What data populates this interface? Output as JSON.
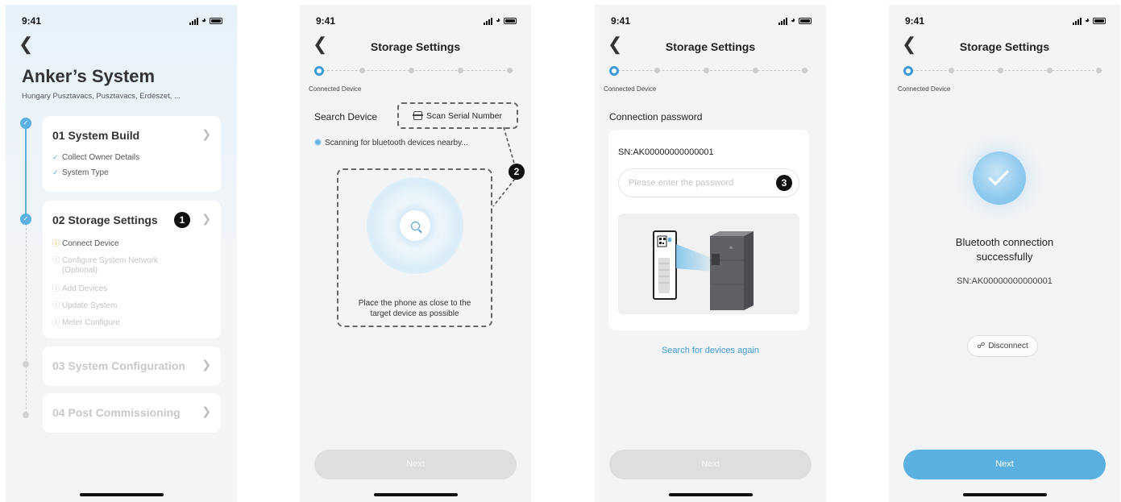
{
  "status_time": "9:41",
  "screen1": {
    "title": "Anker’s System",
    "address": "Hungary Pusztavacs, Pusztavacs, Erdészet, ...",
    "steps": [
      {
        "label": "01 System Build",
        "items": [
          "Collect Owner Details",
          "System Type"
        ]
      },
      {
        "label": "02 Storage Settings",
        "items": [
          "Connect Device",
          "Configure System Network",
          "(Optional)",
          "Add Devices",
          "Update System",
          "Meter Configure"
        ]
      },
      {
        "label": "03 System Configuration"
      },
      {
        "label": "04 Post Commissioning"
      }
    ],
    "badge": "1"
  },
  "header": {
    "title": "Storage Settings"
  },
  "stepper_label": "Connected Device",
  "screen2": {
    "search_label": "Search Device",
    "scan_button": "Scan Serial Number",
    "scanning_text": "Scanning for bluetooth devices nearby...",
    "hint_line1": "Place the phone as close to the",
    "hint_line2": "target device as possible",
    "badge": "2",
    "next": "Next"
  },
  "screen3": {
    "section_label": "Connection password",
    "serial": "SN:AK00000000000001",
    "password_placeholder": "Please enter the password",
    "search_again": "Search for devices again",
    "badge": "3",
    "next": "Next"
  },
  "screen4": {
    "success_line1": "Bluetooth connection",
    "success_line2": "successfully",
    "serial": "SN:AK00000000000001",
    "disconnect": "Disconnect",
    "next": "Next"
  },
  "colors": {
    "accent": "#5ab0e0",
    "link": "#3d9ad8",
    "warning": "#f0a020",
    "disabled": "#dedede"
  },
  "icons": [
    "back-arrow-icon",
    "check-icon",
    "warning-icon",
    "info-icon",
    "scan-icon",
    "search-icon",
    "disconnect-icon",
    "success-check-icon"
  ]
}
